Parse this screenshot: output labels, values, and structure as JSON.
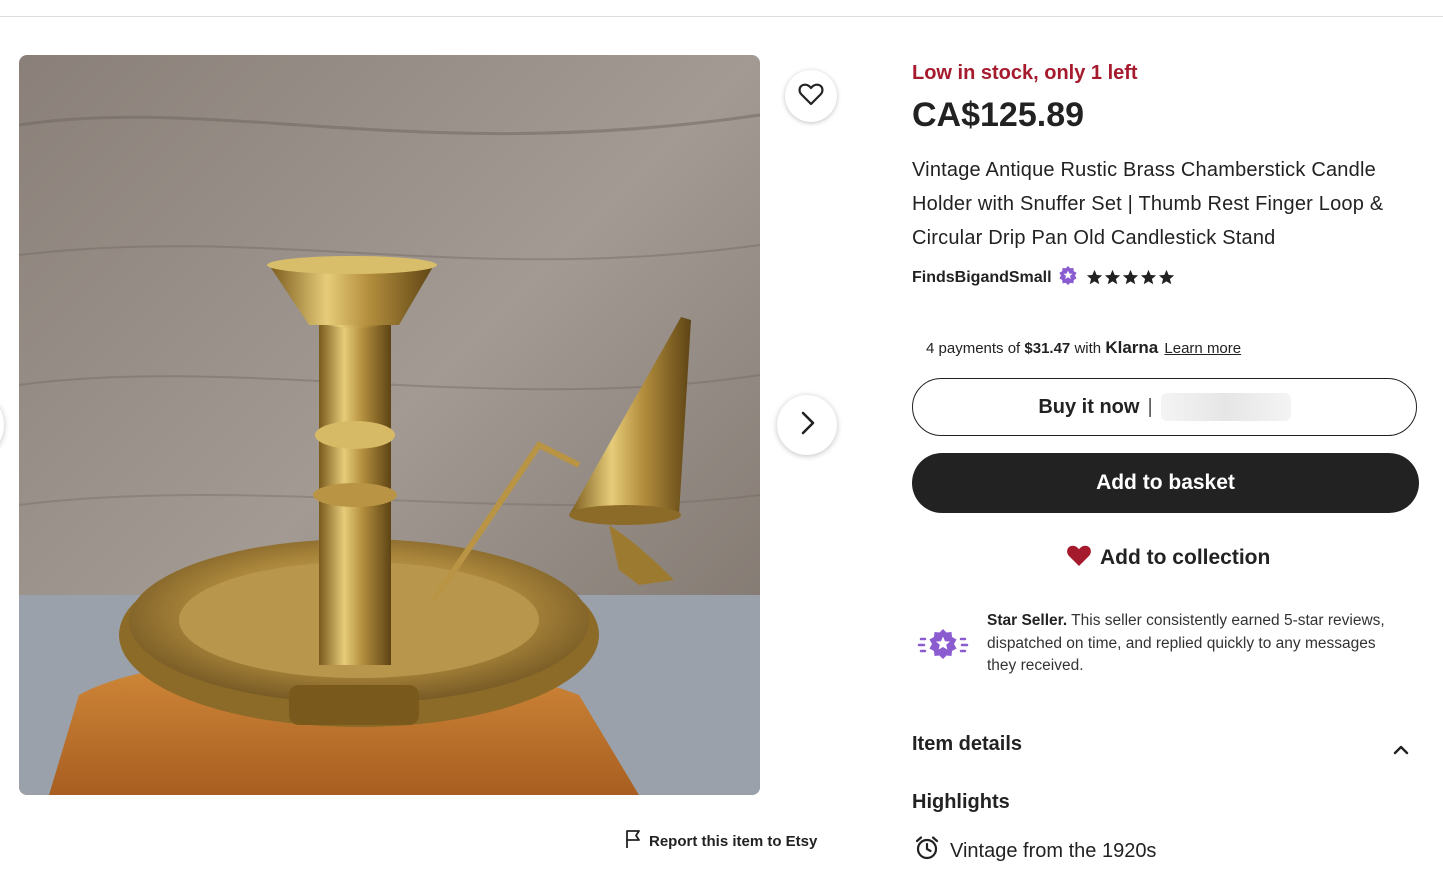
{
  "product": {
    "stock_status": "Low in stock, only 1 left",
    "price": "CA$125.89",
    "title": "Vintage Antique Rustic Brass Chamberstick Candle Holder with Snuffer Set | Thumb Rest Finger Loop & Circular Drip Pan Old Candlestick Stand",
    "seller_name": "FindsBigandSmall",
    "rating_stars": 5
  },
  "payment": {
    "klarna_prefix": "4 payments of",
    "klarna_amount": "$31.47",
    "klarna_with": "with",
    "klarna_brand": "Klarna",
    "learn_more": "Learn more"
  },
  "actions": {
    "buy_now": "Buy it now",
    "buy_sep": "|",
    "add_to_basket": "Add to basket",
    "add_to_collection": "Add to collection"
  },
  "star_seller": {
    "label": "Star Seller.",
    "text": "This seller consistently earned 5-star reviews, dispatched on time, and replied quickly to any messages they received."
  },
  "item_details": {
    "heading": "Item details",
    "highlights_heading": "Highlights",
    "highlight_1": "Vintage from the 1920s"
  },
  "gallery": {
    "report_link": "Report this item to Etsy"
  },
  "icons": [
    "heart-outline-icon",
    "chevron-right-icon",
    "flag-icon",
    "star-seller-badge-icon",
    "star-icon",
    "heart-filled-icon",
    "chevron-up-icon",
    "alarm-clock-icon"
  ],
  "colors": {
    "stock_red": "#a61a2e",
    "button_dark": "#222222",
    "star_seller_purple": "#7f3fbf",
    "heart_red": "#a61a2e"
  }
}
